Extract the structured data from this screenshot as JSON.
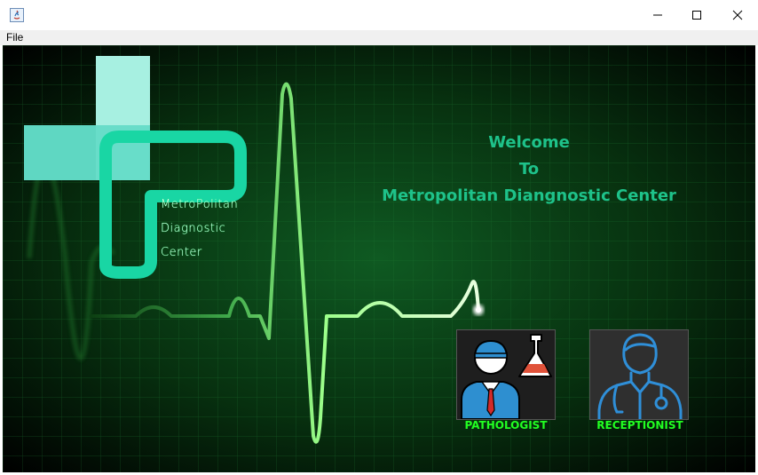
{
  "menu": {
    "file": "File"
  },
  "welcome": {
    "line1": "Welcome",
    "line2": "To",
    "line3": "Metropolitan Diangnostic Center"
  },
  "logo": {
    "line1": "MetroPolitan",
    "line2": "Diagnostic",
    "line3": "Center"
  },
  "roles": [
    {
      "label": "PATHOLOGIST",
      "icon": "pathologist-icon"
    },
    {
      "label": "RECEPTIONIST",
      "icon": "receptionist-icon"
    }
  ],
  "colors": {
    "accent": "#1ec28a",
    "role_label": "#22ff22",
    "background": "#000000",
    "grid": "#0d4a1a",
    "ecg": "#7dff7d"
  }
}
